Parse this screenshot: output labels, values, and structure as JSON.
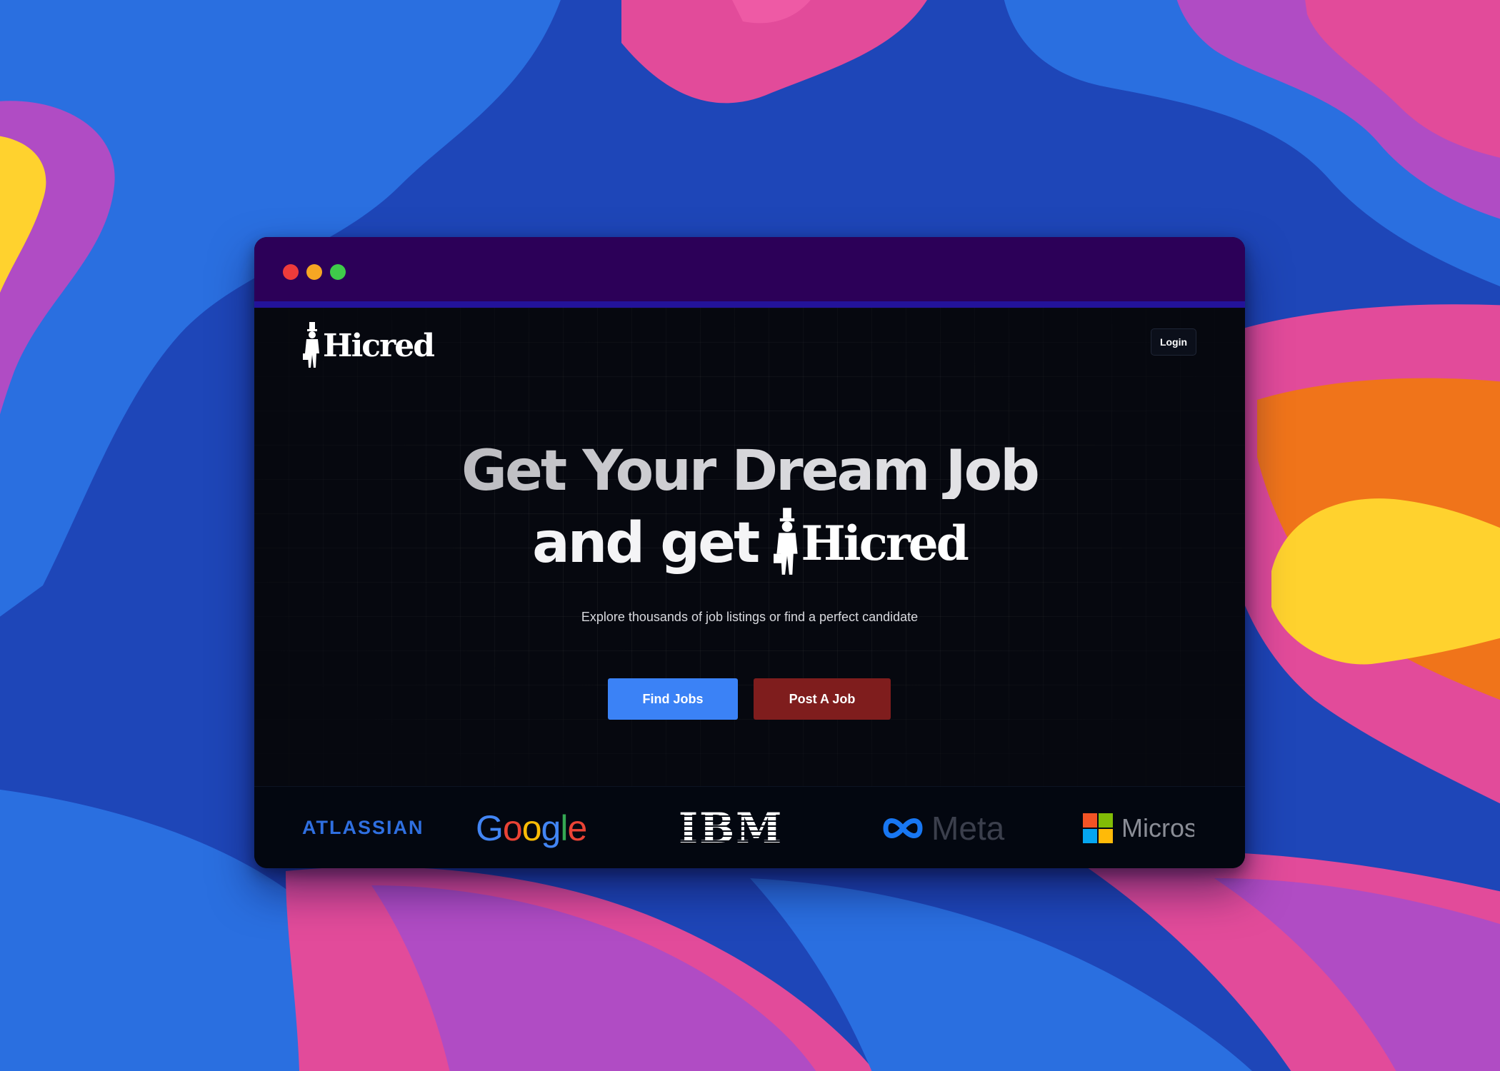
{
  "window": {
    "traffic_lights": [
      "close",
      "minimize",
      "maximize"
    ]
  },
  "nav": {
    "logo_text": "Hicred",
    "login_label": "Login"
  },
  "hero": {
    "headline_line1": "Get Your Dream Job",
    "headline_line2": "and get",
    "headline_logo_text": "Hicred",
    "subtitle": "Explore thousands of job listings or find a perfect candidate"
  },
  "actions": {
    "find_jobs_label": "Find Jobs",
    "post_job_label": "Post A Job"
  },
  "brands": {
    "atlassian": "ATLASSIAN",
    "google": "Google",
    "ibm": "IBM",
    "meta": "Meta",
    "microsoft": "Micros"
  },
  "colors": {
    "titlebar": "#2c0058",
    "find_jobs": "#3b82f6",
    "post_job": "#7f1d1d",
    "page_bg": "#06080f"
  }
}
